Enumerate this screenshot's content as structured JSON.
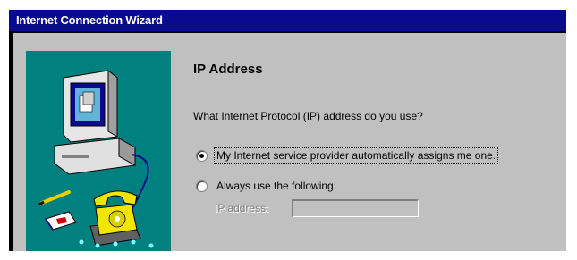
{
  "window": {
    "title": "Internet Connection Wizard"
  },
  "page": {
    "heading": "IP Address",
    "question": "What Internet Protocol (IP) address do you use?"
  },
  "options": [
    {
      "label": "My Internet service provider automatically assigns me one.",
      "selected": true
    },
    {
      "label": "Always use the following:",
      "selected": false
    }
  ],
  "ip_field": {
    "label": "IP address:",
    "value": "",
    "enabled": false
  },
  "illustration": {
    "icons": [
      "computer-icon",
      "telephone-icon",
      "pencil-icon",
      "envelope-icon",
      "network-dots-icon"
    ]
  },
  "colors": {
    "title_bar": "#0a0a8c",
    "art_background": "#00807f",
    "dialog_face": "#c0c0c0"
  }
}
